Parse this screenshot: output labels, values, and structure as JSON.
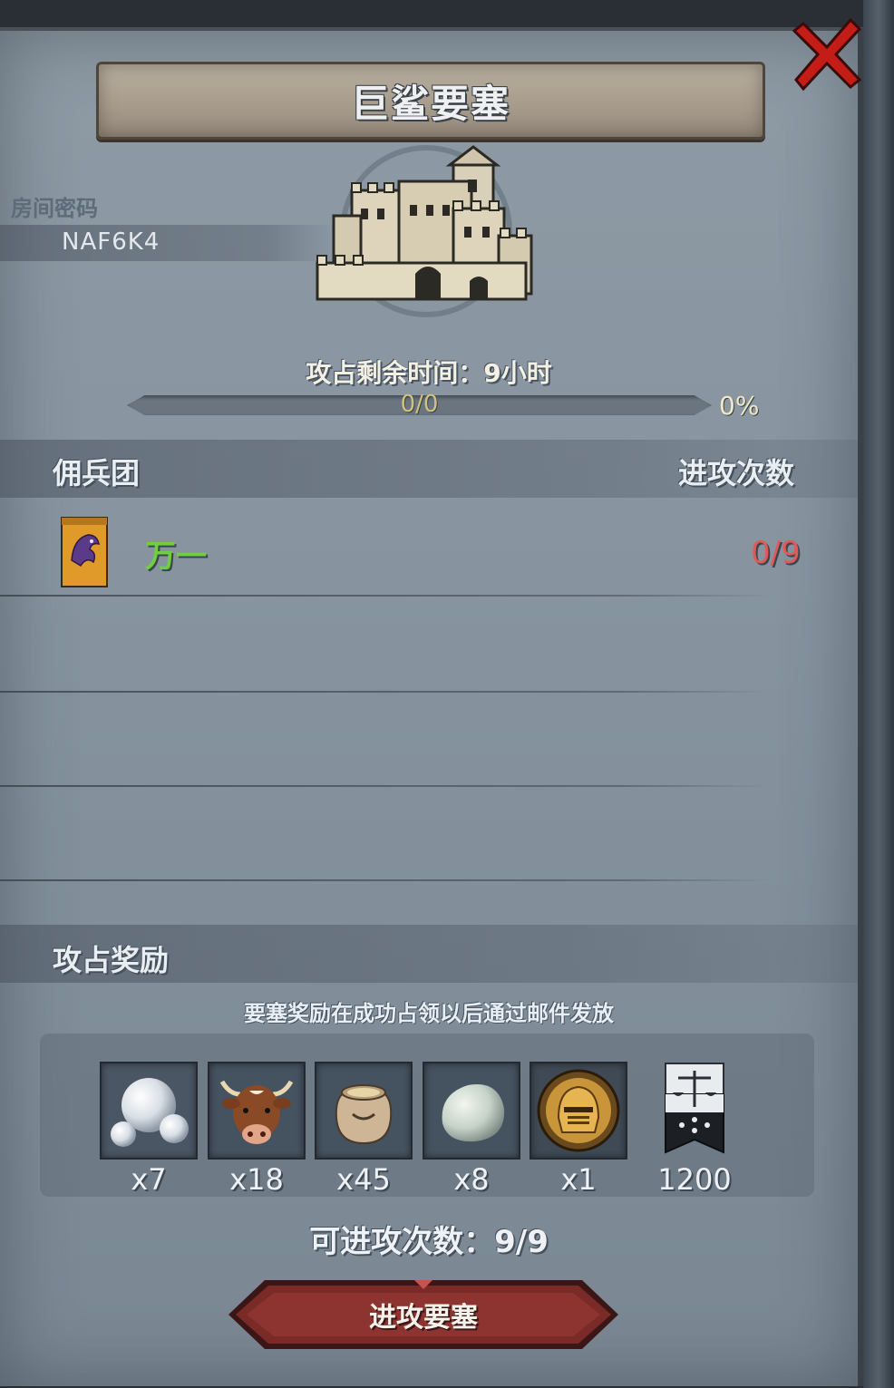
{
  "dialog": {
    "title": "巨鲨要塞",
    "close_icon": "close-x-icon"
  },
  "room": {
    "label": "房间密码",
    "code": "NAF6K4"
  },
  "fortress": {
    "icon": "castle-icon",
    "countdown": "攻占剩余时间：9小时",
    "progress_text": "0/0",
    "progress_percent": "0%",
    "progress_value": 0
  },
  "mercenary": {
    "header_left": "佣兵团",
    "header_right": "进攻次数",
    "rows": [
      {
        "icon": "guild-banner-icon",
        "name": "万一",
        "attacks": "0/9"
      }
    ]
  },
  "rewards": {
    "title": "攻占奖励",
    "note": "要塞奖励在成功占领以后通过邮件发放",
    "items": [
      {
        "icon": "pearl-icon",
        "qty": "x7"
      },
      {
        "icon": "ox-icon",
        "qty": "x18"
      },
      {
        "icon": "grain-sack-icon",
        "qty": "x45"
      },
      {
        "icon": "stone-icon",
        "qty": "x8"
      },
      {
        "icon": "knight-helmet-icon",
        "qty": "x1"
      },
      {
        "icon": "justice-scales-banner-icon",
        "qty": "1200"
      }
    ]
  },
  "footer": {
    "attack_count": "可进攻次数：9/9",
    "attack_button": "进攻要塞"
  },
  "colors": {
    "panel": "#8794a0",
    "guild_name": "#6fcf3e",
    "attack_count_red": "#e05a55",
    "button_red": "#7a2a27"
  }
}
